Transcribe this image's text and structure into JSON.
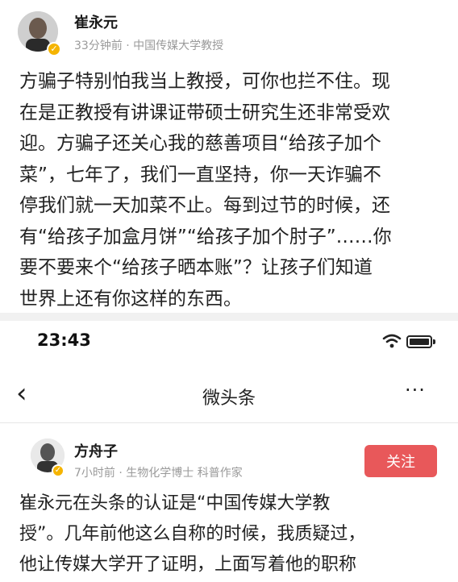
{
  "post1": {
    "author": "崔永元",
    "meta": "33分钟前 · 中国传媒大学教授",
    "lines": [
      "方骗子特别怕我当上教授，可你也拦不住。现",
      "在是正教授有讲课证带硕士研究生还非常受欢",
      "迎。方骗子还关心我的慈善项目“给孩子加个",
      "菜”，七年了，我们一直坚持，你一天诈骗不",
      "停我们就一天加菜不止。每到过节的时候，还",
      "有“给孩子加盒月饼”“给孩子加个肘子”……你",
      "要不要来个“给孩子晒本账”？让孩子们知道",
      "世界上还有你这样的东西。"
    ]
  },
  "status_bar": {
    "time": "23:43"
  },
  "nav": {
    "back": "‹",
    "title": "微头条",
    "more": "···"
  },
  "post2": {
    "author": "方舟子",
    "meta": "7小时前 · 生物化学博士 科普作家",
    "follow_label": "关注",
    "lines": [
      "崔永元在头条的认证是“中国传媒大学教",
      "授”。几年前他这么自称的时候，我质疑过，",
      "他让传媒大学开了证明，上面写着他的职称"
    ]
  },
  "icons": {
    "verified": "verified-badge-icon",
    "wifi": "wifi-icon",
    "battery": "battery-icon",
    "back": "back-arrow-icon",
    "more": "more-icon"
  },
  "colors": {
    "follow": "#e8585a",
    "verified": "#f5b400",
    "meta": "#9a9a9a"
  }
}
